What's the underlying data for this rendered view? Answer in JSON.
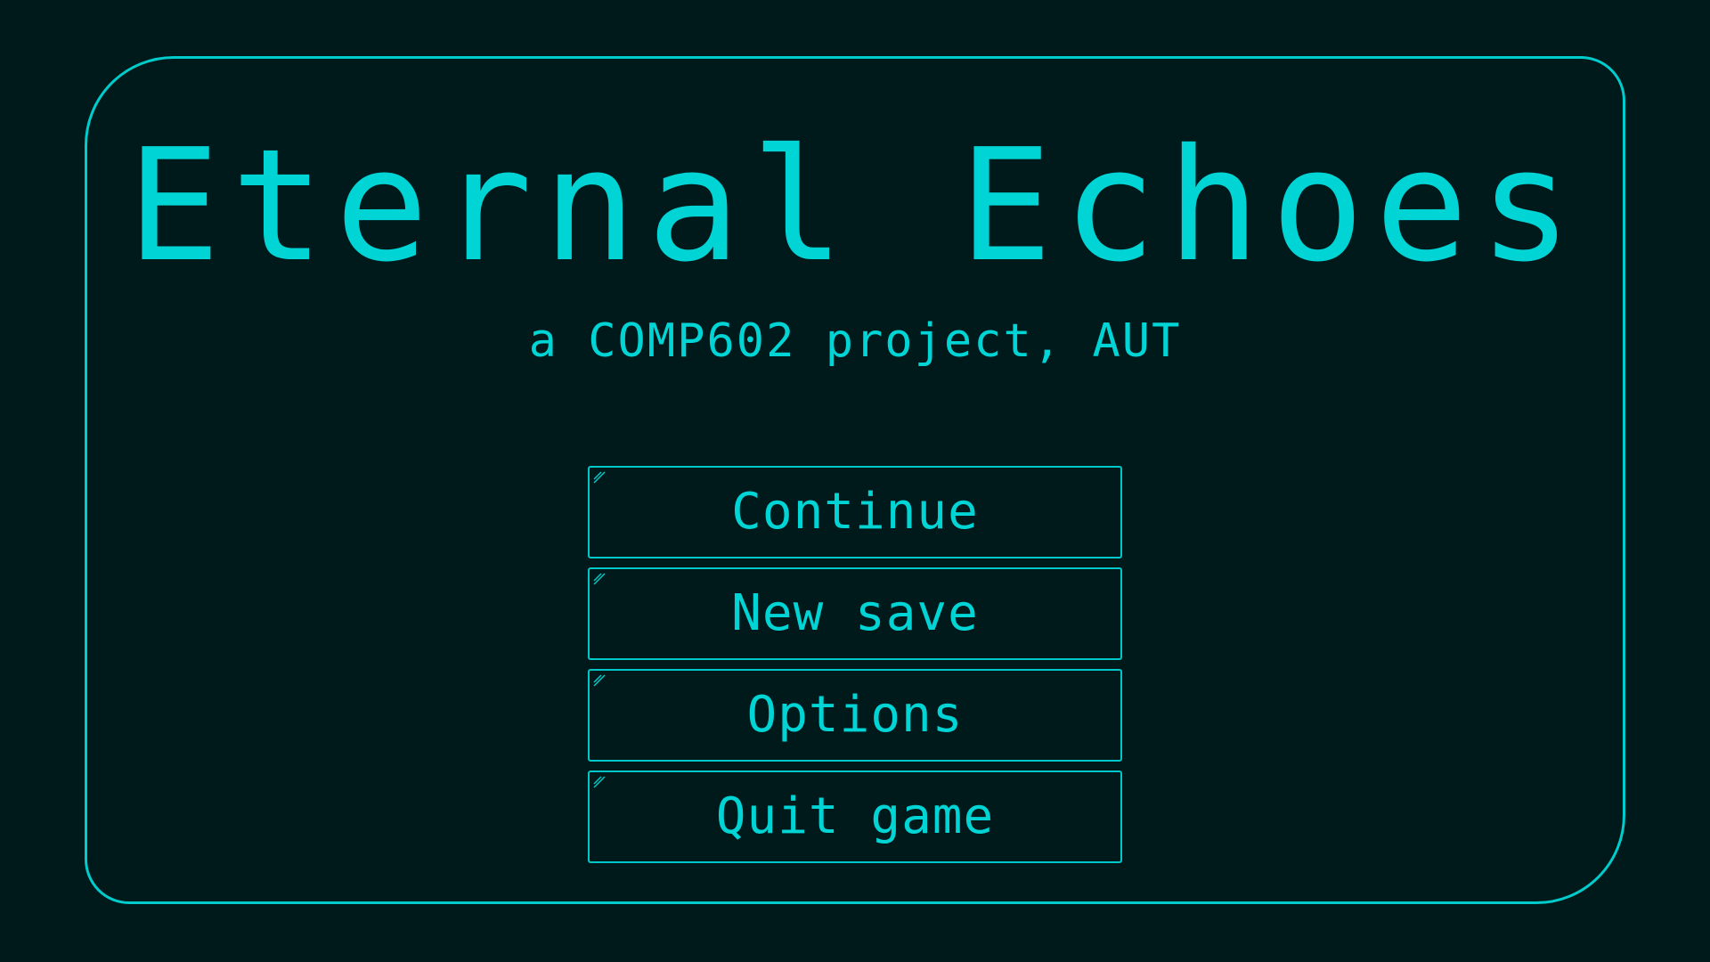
{
  "title": "Eternal Echoes",
  "subtitle": "a COMP602 project, AUT",
  "menu": {
    "items": [
      {
        "label": "Continue",
        "name": "continue-button"
      },
      {
        "label": "New save",
        "name": "new-save-button"
      },
      {
        "label": "Options",
        "name": "options-button"
      },
      {
        "label": "Quit game",
        "name": "quit-game-button"
      }
    ]
  },
  "colors": {
    "background": "#001a1c",
    "accent": "#00d4d4"
  },
  "icons": {
    "button_corner": "corner-hatch-icon"
  }
}
